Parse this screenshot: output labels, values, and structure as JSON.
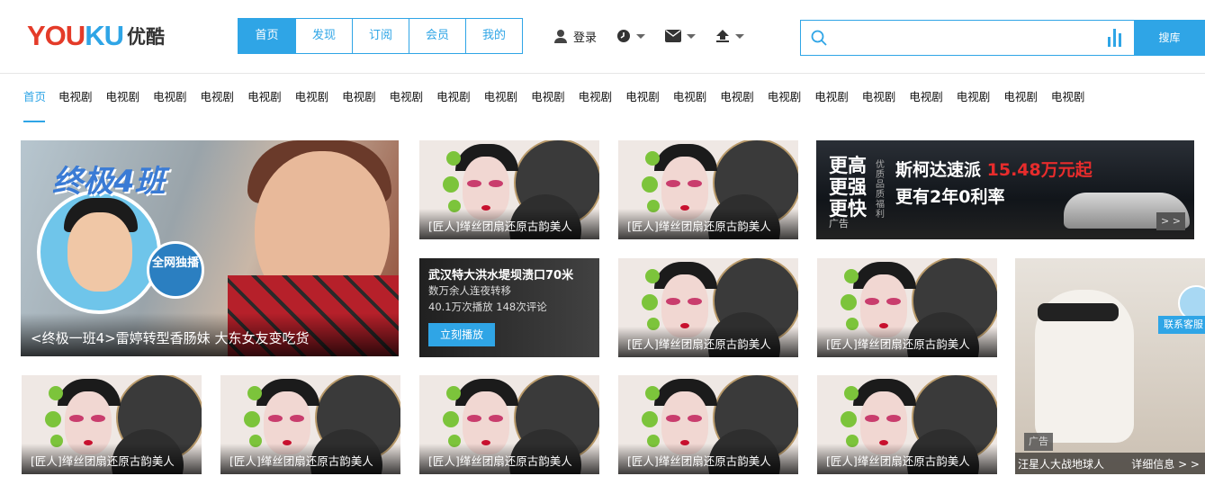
{
  "logo": {
    "latin": "YOUKU",
    "chinese": "优酷"
  },
  "nav": [
    "首页",
    "发现",
    "订阅",
    "会员",
    "我的"
  ],
  "tools": {
    "login": "登录"
  },
  "search": {
    "placeholder": "",
    "button": "搜库"
  },
  "channels": [
    "首页",
    "电视剧",
    "电视剧",
    "电视剧",
    "电视剧",
    "电视剧",
    "电视剧",
    "电视剧",
    "电视剧",
    "电视剧",
    "电视剧",
    "电视剧",
    "电视剧",
    "电视剧",
    "电视剧",
    "电视剧",
    "电视剧",
    "电视剧",
    "电视剧",
    "电视剧",
    "电视剧",
    "电视剧",
    "电视剧"
  ],
  "hero": {
    "title_art": "终极4班",
    "badge": "全网独播",
    "caption": "<终极一班4>雷婷转型香肠妹 大东女友变吃货"
  },
  "opera_caption": "[匠人]缂丝团扇还原古韵美人",
  "news": {
    "title": "武汉特大洪水堤坝溃口70米",
    "sub": "数万余人连夜转移",
    "stats": "40.1万次播放 148次评论",
    "play": "立刻播放"
  },
  "ad_car": {
    "left": [
      "更高",
      "更强",
      "更快"
    ],
    "vertical": "优质 品质 福利",
    "line1": "斯柯达速派",
    "price": "15.48万元起",
    "line2": "更有2年0利率",
    "label": "广告",
    "more": "> >"
  },
  "ad_dog": {
    "contact": "联系客服",
    "label": "广告",
    "caption_left": "汪星人大战地球人",
    "caption_right": "详细信息 > >"
  }
}
